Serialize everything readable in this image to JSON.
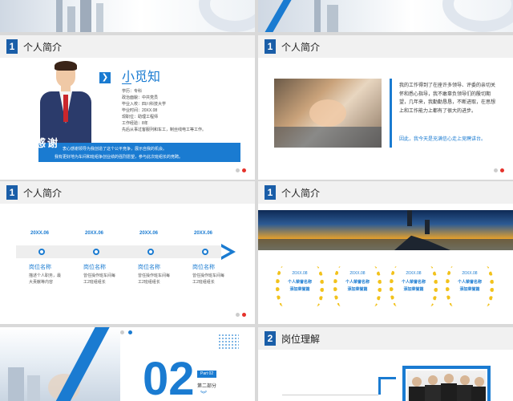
{
  "section1": {
    "number": "1",
    "title": "个人简介"
  },
  "section2": {
    "number": "2",
    "title": "岗位理解"
  },
  "profile": {
    "name": "小觅知",
    "fields": [
      "学历：专科",
      "政治面貌：中共党员",
      "毕业入校：四川科技大学",
      "毕业时间：20XX.08",
      "现职位：助理工程师",
      "工作经验：8年",
      "先后从事过客服列和车工，制丝线电工等工作。"
    ],
    "thanks_label": "感谢",
    "thanks_line1": "衷心感谢领导为我创造了这个公平竞争，展示自我的机会。",
    "thanks_line2": "我有更好地为车间和班组争创业绩的强烈愿望，参与此次班组长的竞聘。"
  },
  "intro_text": {
    "para1": "我的工作得到了在座许多领导、评委的亲切关怀和悉心指导，我不敢辜负领导们的殷切期望，几年来，我勤勤恳恳，不断进取，在思想上和工作能力上都有了很大的进步。",
    "para2": "因此，我今天是充满信心走上竞聘讲台。"
  },
  "timeline": [
    {
      "date": "20XX.06",
      "position": "岗位名称",
      "desc": "描述个人职务，最大贡献等内容"
    },
    {
      "date": "20XX.06",
      "position": "岗位名称",
      "desc": "曾任操作班车间每工2班组组长"
    },
    {
      "date": "20XX.06",
      "position": "岗位名称",
      "desc": "曾任操作班车间每工2班组组长"
    },
    {
      "date": "20XX.06",
      "position": "岗位名称",
      "desc": "曾任操作班车间每工2班组组长"
    }
  ],
  "awards": [
    {
      "date": "20XX.08",
      "title": "个人荣誉名称",
      "sub": "添加荣誉篇"
    },
    {
      "date": "20XX.08",
      "title": "个人荣誉名称",
      "sub": "添加荣誉篇"
    },
    {
      "date": "20XX.08",
      "title": "个人荣誉名称",
      "sub": "添加荣誉篇"
    },
    {
      "date": "20XX.08",
      "title": "个人荣誉名称",
      "sub": "添加荣誉篇"
    }
  ],
  "part": {
    "big": "02",
    "tag": "Part 02",
    "label": "第二部分"
  },
  "colors": {
    "primary": "#1a7bd1",
    "dark": "#1a5ea8",
    "accent": "#e5322b",
    "gold": "#f2c21b"
  }
}
